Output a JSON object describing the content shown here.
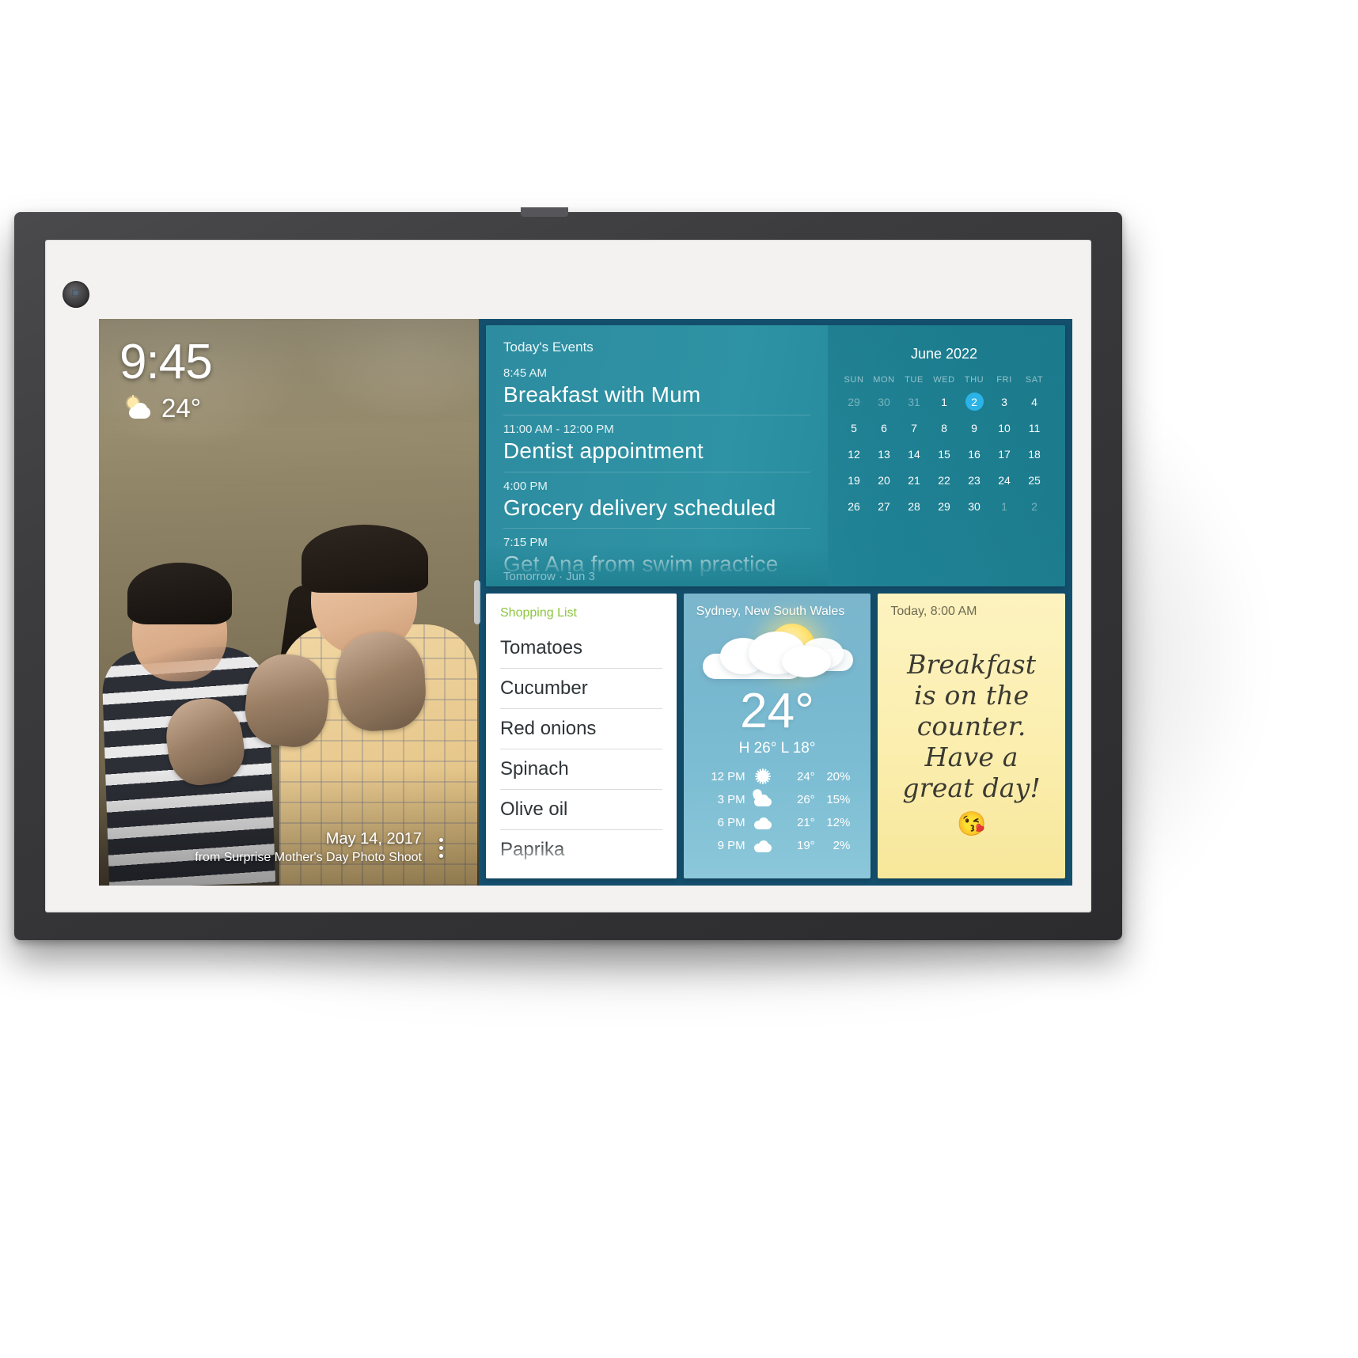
{
  "device": {
    "camera_label": "front-camera",
    "frame_color": "#3a3a3c"
  },
  "photo": {
    "clock": "9:45",
    "temperature": "24°",
    "weather_icon": "sun-behind-cloud-icon",
    "caption_date": "May 14, 2017",
    "caption_source": "from Surprise Mother's Day Photo Shoot",
    "menu_icon": "more-options-icon"
  },
  "events": {
    "title": "Today's Events",
    "items": [
      {
        "time": "8:45 AM",
        "name": "Breakfast with Mum"
      },
      {
        "time": "11:00 AM - 12:00 PM",
        "name": "Dentist appointment"
      },
      {
        "time": "4:00 PM",
        "name": "Grocery delivery scheduled"
      },
      {
        "time": "7:15 PM",
        "name": "Get Ana from swim practice"
      }
    ],
    "next_label": "Tomorrow · Jun 3"
  },
  "calendar": {
    "month": "June 2022",
    "dow": [
      "SUN",
      "MON",
      "TUE",
      "WED",
      "THU",
      "FRI",
      "SAT"
    ],
    "today": 2,
    "weeks": [
      [
        {
          "n": "29",
          "state": "muted"
        },
        {
          "n": "30",
          "state": "muted"
        },
        {
          "n": "31",
          "state": "muted"
        },
        {
          "n": "1",
          "state": "normal"
        },
        {
          "n": "2",
          "state": "today"
        },
        {
          "n": "3",
          "state": "normal"
        },
        {
          "n": "4",
          "state": "normal"
        }
      ],
      [
        {
          "n": "5",
          "state": "normal"
        },
        {
          "n": "6",
          "state": "normal"
        },
        {
          "n": "7",
          "state": "normal"
        },
        {
          "n": "8",
          "state": "normal"
        },
        {
          "n": "9",
          "state": "normal"
        },
        {
          "n": "10",
          "state": "normal"
        },
        {
          "n": "11",
          "state": "normal"
        }
      ],
      [
        {
          "n": "12",
          "state": "normal"
        },
        {
          "n": "13",
          "state": "normal"
        },
        {
          "n": "14",
          "state": "normal"
        },
        {
          "n": "15",
          "state": "normal"
        },
        {
          "n": "16",
          "state": "normal"
        },
        {
          "n": "17",
          "state": "normal"
        },
        {
          "n": "18",
          "state": "normal"
        }
      ],
      [
        {
          "n": "19",
          "state": "normal"
        },
        {
          "n": "20",
          "state": "normal"
        },
        {
          "n": "21",
          "state": "normal"
        },
        {
          "n": "22",
          "state": "normal"
        },
        {
          "n": "23",
          "state": "normal"
        },
        {
          "n": "24",
          "state": "normal"
        },
        {
          "n": "25",
          "state": "normal"
        }
      ],
      [
        {
          "n": "26",
          "state": "normal"
        },
        {
          "n": "27",
          "state": "normal"
        },
        {
          "n": "28",
          "state": "normal"
        },
        {
          "n": "29",
          "state": "normal"
        },
        {
          "n": "30",
          "state": "normal"
        },
        {
          "n": "1",
          "state": "muted"
        },
        {
          "n": "2",
          "state": "muted"
        }
      ]
    ],
    "today_highlight_color": "#2bb3e8"
  },
  "shopping": {
    "title": "Shopping List",
    "title_color": "#8cc63f",
    "items": [
      "Tomatoes",
      "Cucumber",
      "Red onions",
      "Spinach",
      "Olive oil",
      "Paprika"
    ]
  },
  "weather": {
    "location": "Sydney, New South Wales",
    "current_temp": "24°",
    "high_low": "H 26°  L 18°",
    "condition_icon": "sun-behind-cloud-icon",
    "forecast": [
      {
        "time": "12 PM",
        "icon": "sun-icon",
        "temp": "24°",
        "pop": "20%"
      },
      {
        "time": "3 PM",
        "icon": "sun-behind-cloud-icon",
        "temp": "26°",
        "pop": "15%"
      },
      {
        "time": "6 PM",
        "icon": "cloud-icon",
        "temp": "21°",
        "pop": "12%"
      },
      {
        "time": "9 PM",
        "icon": "cloud-icon",
        "temp": "19°",
        "pop": "2%"
      }
    ]
  },
  "note": {
    "time": "Today, 8:00 AM",
    "lines": [
      "Breakfast",
      "is on the",
      "counter.",
      "Have a",
      "great day!"
    ],
    "emoji": "😘",
    "paper_color": "#fbeeae"
  }
}
